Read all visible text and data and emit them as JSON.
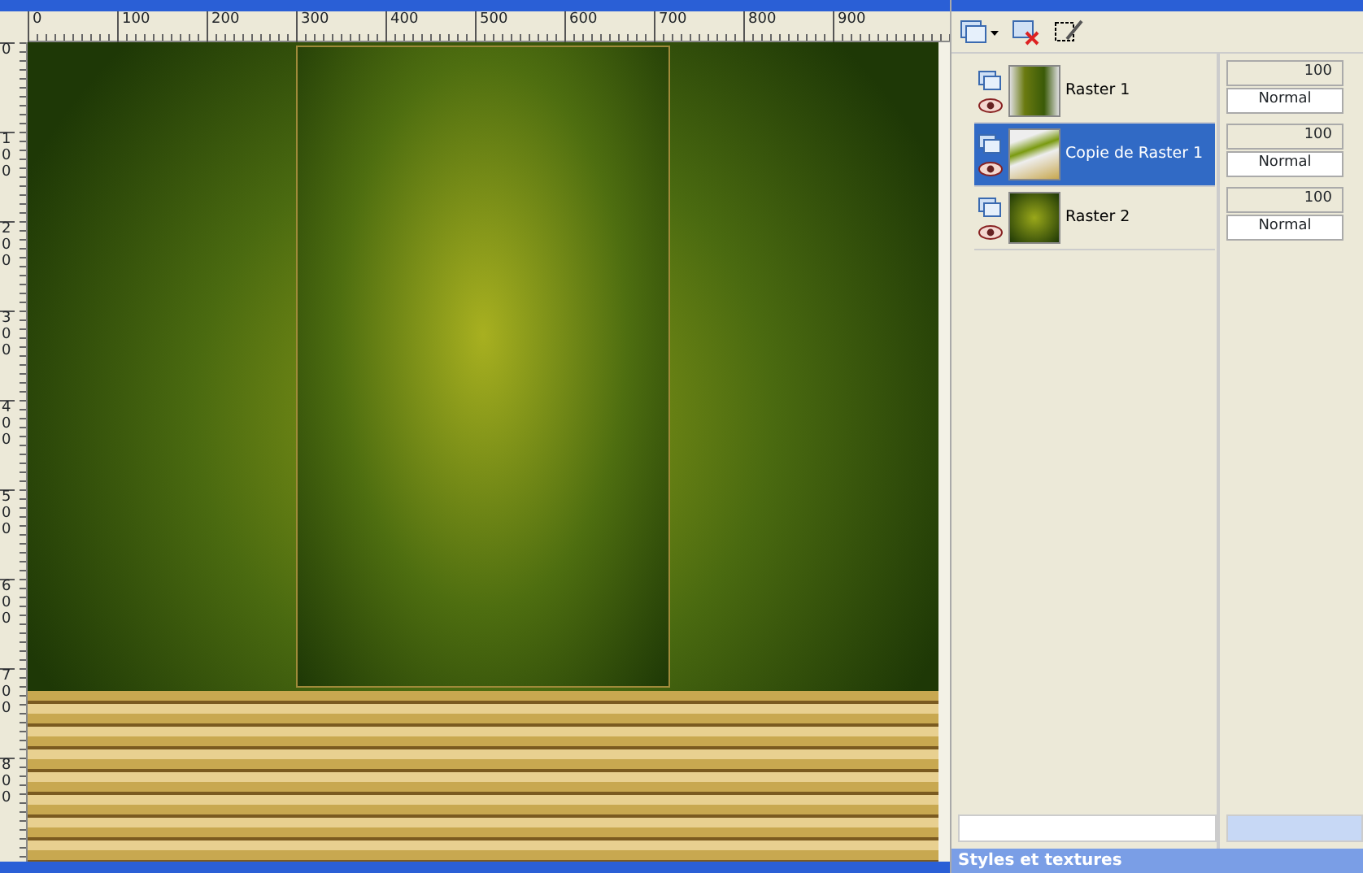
{
  "rulers": {
    "horizontal": [
      "0",
      "100",
      "200",
      "300",
      "400",
      "500",
      "600",
      "700",
      "800",
      "900"
    ],
    "vertical": [
      "0",
      "100",
      "200",
      "300",
      "400",
      "500",
      "600",
      "700",
      "800"
    ]
  },
  "layers_panel": {
    "layers": [
      {
        "name": "Raster 1",
        "selected": false,
        "opacity": "100",
        "blend_mode": "Normal"
      },
      {
        "name": "Copie de Raster 1",
        "selected": true,
        "opacity": "100",
        "blend_mode": "Normal"
      },
      {
        "name": "Raster 2",
        "selected": false,
        "opacity": "100",
        "blend_mode": "Normal"
      }
    ]
  },
  "styles_panel": {
    "title": "Styles et textures"
  }
}
